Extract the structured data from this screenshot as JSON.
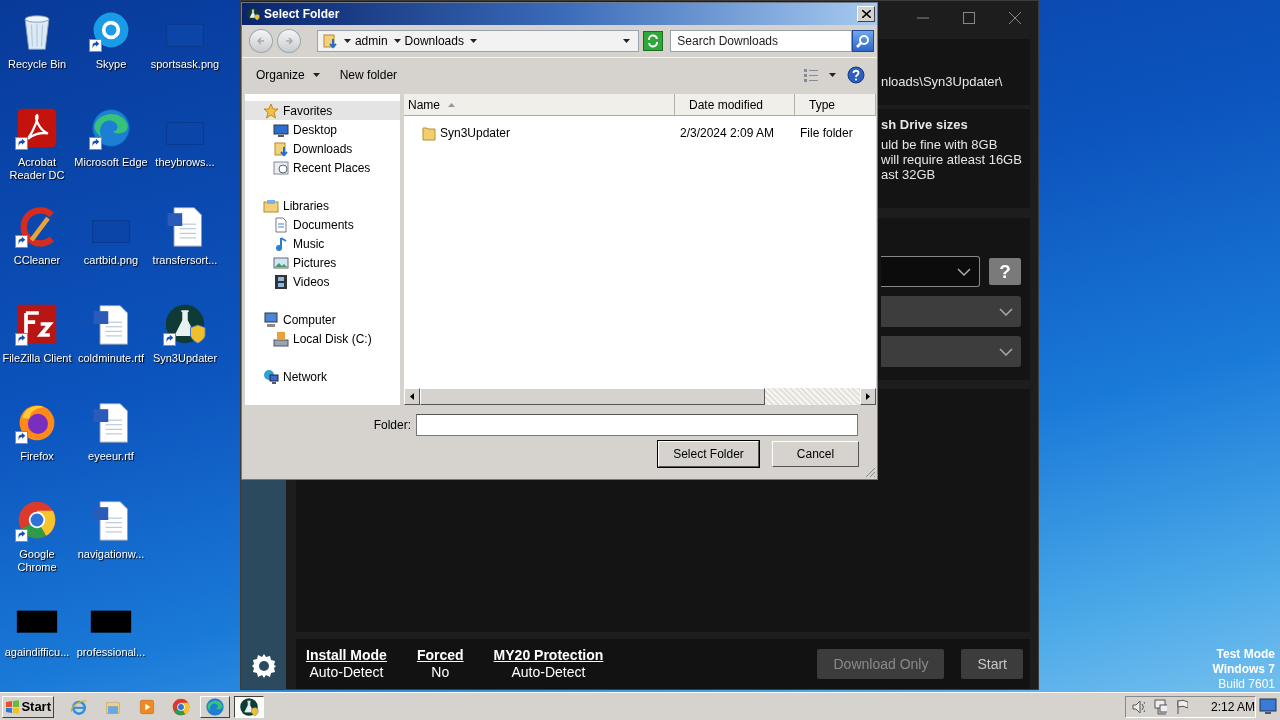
{
  "desktop": {
    "columns": [
      [
        {
          "label": "Recycle Bin",
          "kind": "recycle-bin",
          "shortcut": false
        },
        {
          "label": "Acrobat Reader DC",
          "kind": "acrobat",
          "shortcut": true
        },
        {
          "label": "CCleaner",
          "kind": "ccleaner",
          "shortcut": true
        },
        {
          "label": "FileZilla Client",
          "kind": "filezilla",
          "shortcut": true
        },
        {
          "label": "Firefox",
          "kind": "firefox",
          "shortcut": true
        },
        {
          "label": "Google Chrome",
          "kind": "chrome",
          "shortcut": true
        },
        {
          "label": "againdifficu...",
          "kind": "black-image",
          "shortcut": false
        }
      ],
      [
        {
          "label": "Skype",
          "kind": "skype",
          "shortcut": true
        },
        {
          "label": "Microsoft Edge",
          "kind": "edge",
          "shortcut": true
        },
        {
          "label": "cartbid.png",
          "kind": "image",
          "shortcut": false
        },
        {
          "label": "coldminute.rtf",
          "kind": "word",
          "shortcut": false
        },
        {
          "label": "eyeeur.rtf",
          "kind": "word",
          "shortcut": false
        },
        {
          "label": "navigationw...",
          "kind": "word",
          "shortcut": false
        },
        {
          "label": "professional...",
          "kind": "black-image",
          "shortcut": false
        }
      ],
      [
        {
          "label": "sportsask.png",
          "kind": "image",
          "shortcut": false
        },
        {
          "label": "theybrows...",
          "kind": "image",
          "shortcut": false
        },
        {
          "label": "transfersort...",
          "kind": "word",
          "shortcut": false
        },
        {
          "label": "Syn3Updater",
          "kind": "syn3",
          "shortcut": true
        }
      ]
    ],
    "os_info": [
      {
        "text": "Test Mode",
        "bold": true
      },
      {
        "text": "Windows 7",
        "bold": true
      },
      {
        "text": "Build 7601",
        "bold": false
      }
    ]
  },
  "app_window": {
    "path_text": "nloads\\Syn3Updater\\",
    "drive_info": {
      "title": "sh Drive sizes",
      "lines": [
        "uld be fine with 8GB",
        "will require atleast 16GB",
        "ast 32GB"
      ]
    },
    "help_button": "?",
    "status": [
      {
        "label": "Install Mode",
        "value": "Auto-Detect"
      },
      {
        "label": "Forced",
        "value": "No"
      },
      {
        "label": "MY20 Protection",
        "value": "Auto-Detect"
      }
    ],
    "buttons": [
      {
        "label": "Download Only",
        "disabled": true
      },
      {
        "label": "Start",
        "disabled": false
      }
    ]
  },
  "dialog": {
    "title": "Select Folder",
    "breadcrumb": [
      "admin",
      "Downloads"
    ],
    "search": {
      "placeholder": "Search Downloads"
    },
    "toolbar": [
      {
        "label": "Organize",
        "menu": true
      },
      {
        "label": "New folder",
        "menu": false
      }
    ],
    "nav": [
      {
        "label": "Favorites",
        "kind": "favorites",
        "selected": true,
        "children": [
          {
            "label": "Desktop",
            "kind": "desktop",
            "selected": false
          },
          {
            "label": "Downloads",
            "kind": "downloads",
            "selected": false
          },
          {
            "label": "Recent Places",
            "kind": "recent",
            "selected": false
          }
        ]
      },
      {
        "label": "Libraries",
        "kind": "libraries",
        "selected": false,
        "children": [
          {
            "label": "Documents",
            "kind": "documents",
            "selected": false
          },
          {
            "label": "Music",
            "kind": "music",
            "selected": false
          },
          {
            "label": "Pictures",
            "kind": "pictures",
            "selected": false
          },
          {
            "label": "Videos",
            "kind": "videos",
            "selected": false
          }
        ]
      },
      {
        "label": "Computer",
        "kind": "computer",
        "selected": false,
        "children": [
          {
            "label": "Local Disk (C:)",
            "kind": "disk",
            "selected": false
          }
        ]
      },
      {
        "label": "Network",
        "kind": "network",
        "selected": false
      }
    ],
    "columns": [
      {
        "label": "Name",
        "sorted": true
      },
      {
        "label": "Date modified",
        "sorted": false
      },
      {
        "label": "Type",
        "sorted": false
      }
    ],
    "rows": [
      {
        "name": "Syn3Updater",
        "date_modified": "2/3/2024 2:09 AM",
        "type": "File folder"
      }
    ],
    "folder_label": "Folder:",
    "buttons": [
      {
        "label": "Select Folder",
        "default": true
      },
      {
        "label": "Cancel",
        "default": false
      }
    ]
  },
  "taskbar": {
    "start": "Start",
    "apps": [
      {
        "kind": "ie",
        "open": false,
        "selected": false
      },
      {
        "kind": "explorer",
        "open": false,
        "selected": false
      },
      {
        "kind": "media",
        "open": false,
        "selected": false
      },
      {
        "kind": "chrome",
        "open": false,
        "selected": false
      },
      {
        "kind": "edge",
        "open": true,
        "selected": false
      },
      {
        "kind": "syn3",
        "open": true,
        "selected": true
      }
    ],
    "clock": "2:12 AM"
  }
}
